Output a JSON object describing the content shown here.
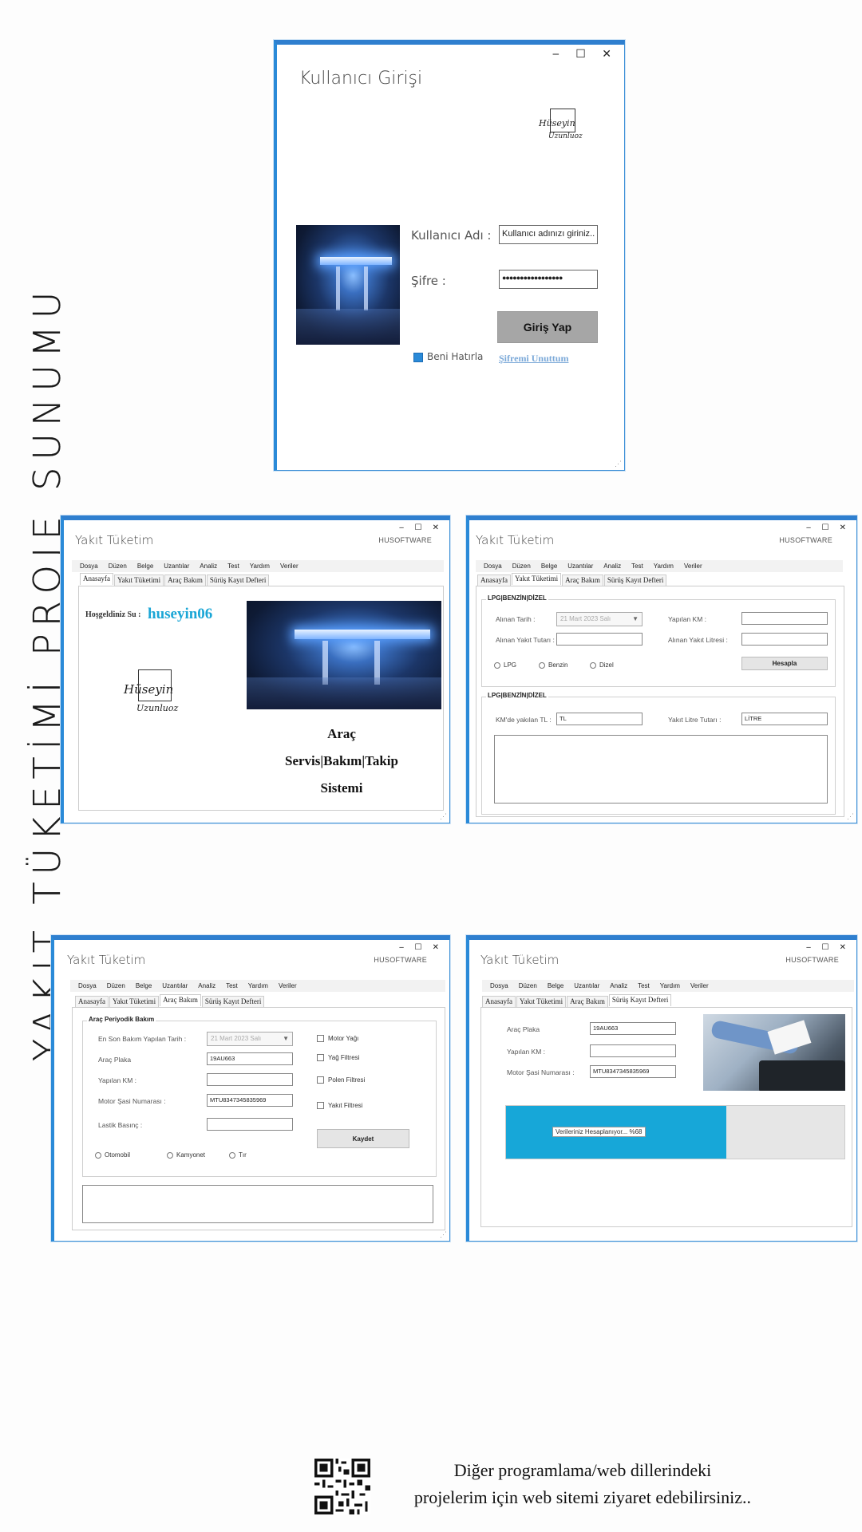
{
  "side_title": "YAKIT TÜKETİMİ PROJE SUNUMU",
  "window_controls": "‒ ☐ ✕",
  "login": {
    "title": "Kullanıcı Girişi",
    "username_label": "Kullanıcı Adı :",
    "username_placeholder": "Kullanıcı adınızı giriniz..",
    "password_label": "Şifre :",
    "password_value": "●●●●●●●●●●●●●●●●●",
    "login_button": "Giriş Yap",
    "remember_label": "Beni Hatırla",
    "forgot_link": "Şifremi Unuttum"
  },
  "app": {
    "title": "Yakıt Tüketim",
    "brand": "HUSOFTWARE",
    "menu": [
      "Dosya",
      "Düzen",
      "Belge",
      "Uzantılar",
      "Analiz",
      "Test",
      "Yardım",
      "Veriler"
    ],
    "tabs": [
      "Anasayfa",
      "Yakıt Tüketimi",
      "Araç Bakım",
      "Sürüş Kayıt Defteri"
    ]
  },
  "home": {
    "welcome_label": "Hoşgeldiniz Su :",
    "username": "huseyin06",
    "system_line1": "Araç",
    "system_line2": "Servis|Bakım|Takip",
    "system_line3": "Sistemi"
  },
  "fuel": {
    "group1_title": "LPG|BENZİN|DİZEL",
    "date_label": "Alınan Tarih :",
    "date_value": "21 Mart 2023 Salı",
    "km_label": "Yapılan KM :",
    "amount_label": "Alınan Yakıt Tutarı :",
    "liters_label": "Alınan Yakıt Litresi :",
    "radios": [
      "LPG",
      "Benzin",
      "Dizel"
    ],
    "calc_button": "Hesapla",
    "group2_title": "LPG|BENZİN|DİZEL",
    "km_tl_label": "KM'de yakılan TL :",
    "km_tl_value": "TL",
    "liter_amount_label": "Yakıt Litre Tutarı :",
    "liter_amount_value": "LİTRE"
  },
  "maintenance": {
    "group_title": "Araç Periyodik Bakım",
    "last_date_label": "En Son Bakım Yapılan Tarih :",
    "last_date_value": "21 Mart 2023 Salı",
    "plate_label": "Araç Plaka",
    "plate_value": "19AU663",
    "km_label": "Yapılan KM :",
    "chassis_label": "Motor Şasi Numarası :",
    "chassis_value": "MTU8347345835969",
    "tire_label": "Lastik Basınç :",
    "checks": [
      "Motor Yağı",
      "Yağ Filtresi",
      "Polen Filtresi",
      "Yakıt Filtresi"
    ],
    "save_button": "Kaydet",
    "radios": [
      "Otomobil",
      "Kamyonet",
      "Tır"
    ]
  },
  "log": {
    "plate_label": "Araç Plaka",
    "plate_value": "19AU663",
    "km_label": "Yapılan KM :",
    "chassis_label": "Motor Şasi Numarası :",
    "chassis_value": "MTU8347345835969",
    "progress_text": "Verileriniz Hesaplanıyor... %68",
    "progress_fraction": 0.65
  },
  "signature": {
    "line1": "Hüseyin",
    "line2": "Uzunluoz"
  },
  "footer": {
    "line1": "Diğer programlama/web dillerindeki",
    "line2": "projelerim için web sitemi ziyaret edebilirsiniz.."
  },
  "colors": {
    "accent": "#2f7fcf",
    "progress": "#17a7d8",
    "username": "#1aa6d6"
  }
}
